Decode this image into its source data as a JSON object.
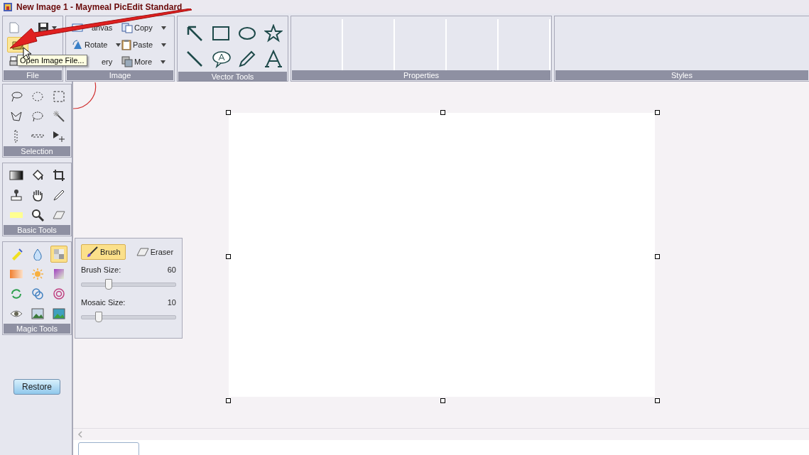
{
  "window": {
    "title": "New Image 1 - Maymeal PicEdit Standard"
  },
  "ribbon": {
    "groups": [
      {
        "kind": "file",
        "label": "File"
      },
      {
        "kind": "image",
        "label": "Image",
        "items": [
          {
            "label": "anvas",
            "dropdown": false
          },
          {
            "label": "Copy",
            "dropdown": true
          },
          {
            "label": "Rotate",
            "dropdown": true
          },
          {
            "label": "Paste",
            "dropdown": true
          },
          {
            "label": "ery",
            "dropdown": false
          },
          {
            "label": "More",
            "dropdown": true
          }
        ]
      },
      {
        "kind": "vector",
        "label": "Vector Tools"
      },
      {
        "kind": "properties",
        "label": "Properties"
      },
      {
        "kind": "styles",
        "label": "Styles"
      }
    ]
  },
  "tooltip": {
    "text": "Open Image File..."
  },
  "tool_panels": [
    {
      "kind": "selection",
      "label": "Selection"
    },
    {
      "kind": "basic",
      "label": "Basic Tools"
    },
    {
      "kind": "magic",
      "label": "Magic Tools",
      "tools": [
        {
          "selected": false
        },
        {
          "selected": false
        },
        {
          "selected": true
        },
        {
          "selected": false
        },
        {
          "selected": false
        },
        {
          "selected": false
        },
        {
          "selected": false
        },
        {
          "selected": false
        },
        {
          "selected": false
        },
        {
          "selected": false
        },
        {
          "selected": false
        },
        {
          "selected": false
        }
      ]
    }
  ],
  "restore_button": "Restore",
  "brush_panel": {
    "tabs": [
      {
        "label": "Brush",
        "selected": true
      },
      {
        "label": "Eraser",
        "selected": false
      }
    ],
    "sliders": [
      {
        "label": "Brush Size:",
        "reading": "60",
        "level": 0.29
      },
      {
        "label": "Mosaic Size:",
        "reading": "10",
        "level": 0.18
      }
    ]
  }
}
